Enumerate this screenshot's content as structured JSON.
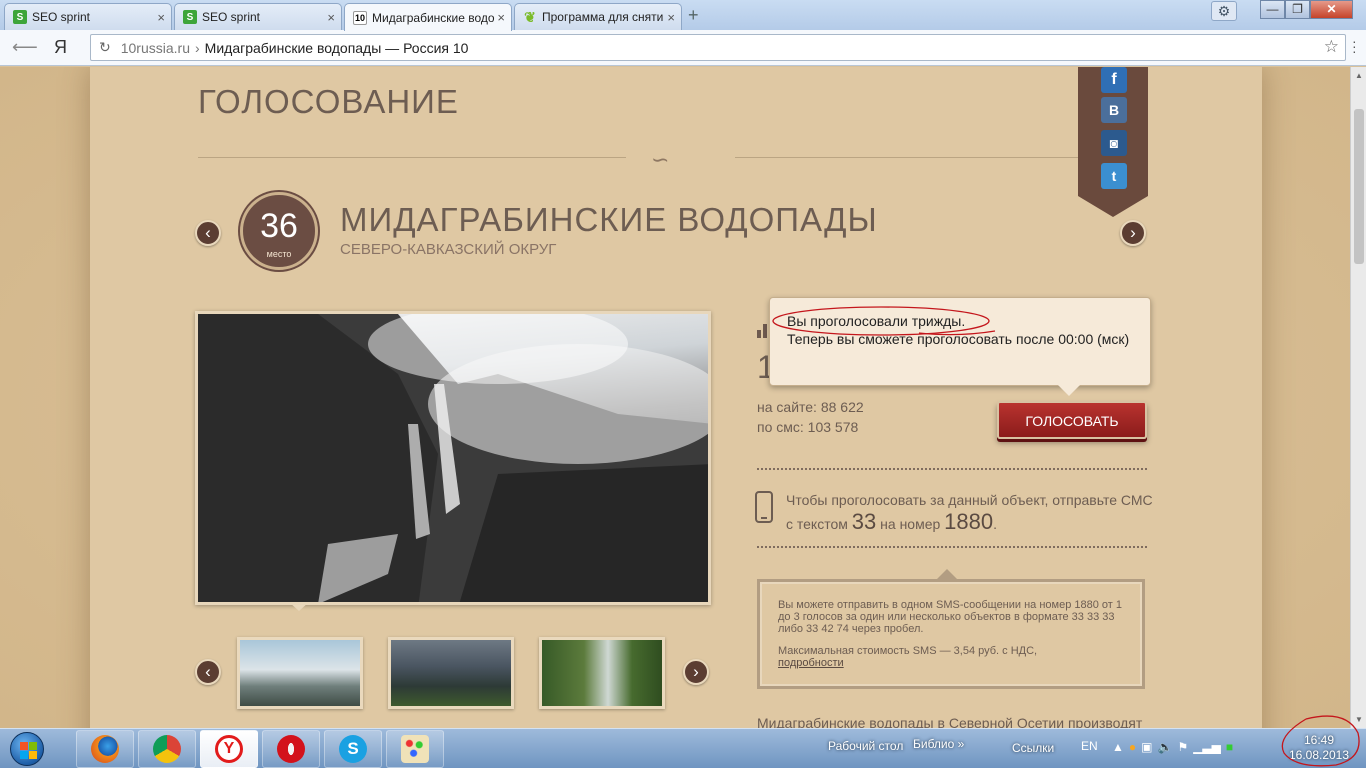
{
  "browser": {
    "tabs": [
      {
        "title": "SEO sprint",
        "icon": "seo-sprint-favicon"
      },
      {
        "title": "SEO sprint",
        "icon": "seo-sprint-favicon"
      },
      {
        "title": "Мидаграбинские водо",
        "icon": "russia10-favicon",
        "favicon_text": "10"
      },
      {
        "title": "Программа для сняти",
        "icon": "leaf-favicon"
      }
    ],
    "new_tab": "+",
    "yandex": "Я",
    "url_domain": "10russia.ru",
    "url_separator": "›",
    "url_title": "Мидаграбинские водопады — Россия 10",
    "window": {
      "minimize": "—",
      "maximize": "❐",
      "close": "✕"
    }
  },
  "page": {
    "section_title": "ГОЛОСОВАНИЕ",
    "social": [
      "f",
      "В",
      "◙",
      "t"
    ],
    "rank": {
      "number": "36",
      "label": "место"
    },
    "place_name": "МИДАГРАБИНСКИЕ ВОДОПАДЫ",
    "region": "СЕВЕРО-КАВКАЗСКИЙ ОКРУГ",
    "votes": {
      "total_partial": "1",
      "on_site": "на сайте: 88 622",
      "by_sms": "по смс: 103 578"
    },
    "vote_button": "ГОЛОСОВАТЬ",
    "tooltip": {
      "line1": "Вы проголосовали трижды.",
      "line2": "Теперь вы сможете проголосовать после 00:00 (мск)"
    },
    "sms": {
      "text_before": "Чтобы проголосовать за данный объект, отправьте СМС с текстом",
      "code": "33",
      "text_mid": "на номер",
      "number": "1880",
      "text_end": "."
    },
    "sms_box": {
      "p1": "Вы можете отправить в одном SMS-сообщении на номер 1880 от 1 до 3 голосов за один или несколько объектов в формате 33 33 33 либо 33 42 74 через пробел.",
      "p2": "Максимальная стоимость SMS — 3,54 руб. с НДС,",
      "link": "подробности"
    },
    "description": "Мидаграбинские водопады в Северной Осетии производят"
  },
  "taskbar": {
    "desktop_label": "Рабочий стол",
    "library_label": "Библио",
    "overflow": "»",
    "links_label": "Ссылки",
    "lang": "EN",
    "time": "16:49",
    "date": "16.08.2013"
  },
  "colors": {
    "page_bg": "#d2b68a",
    "brown_accent": "#6b4d43",
    "vote_red": "#a62624",
    "text_brown": "#6d5d52"
  }
}
